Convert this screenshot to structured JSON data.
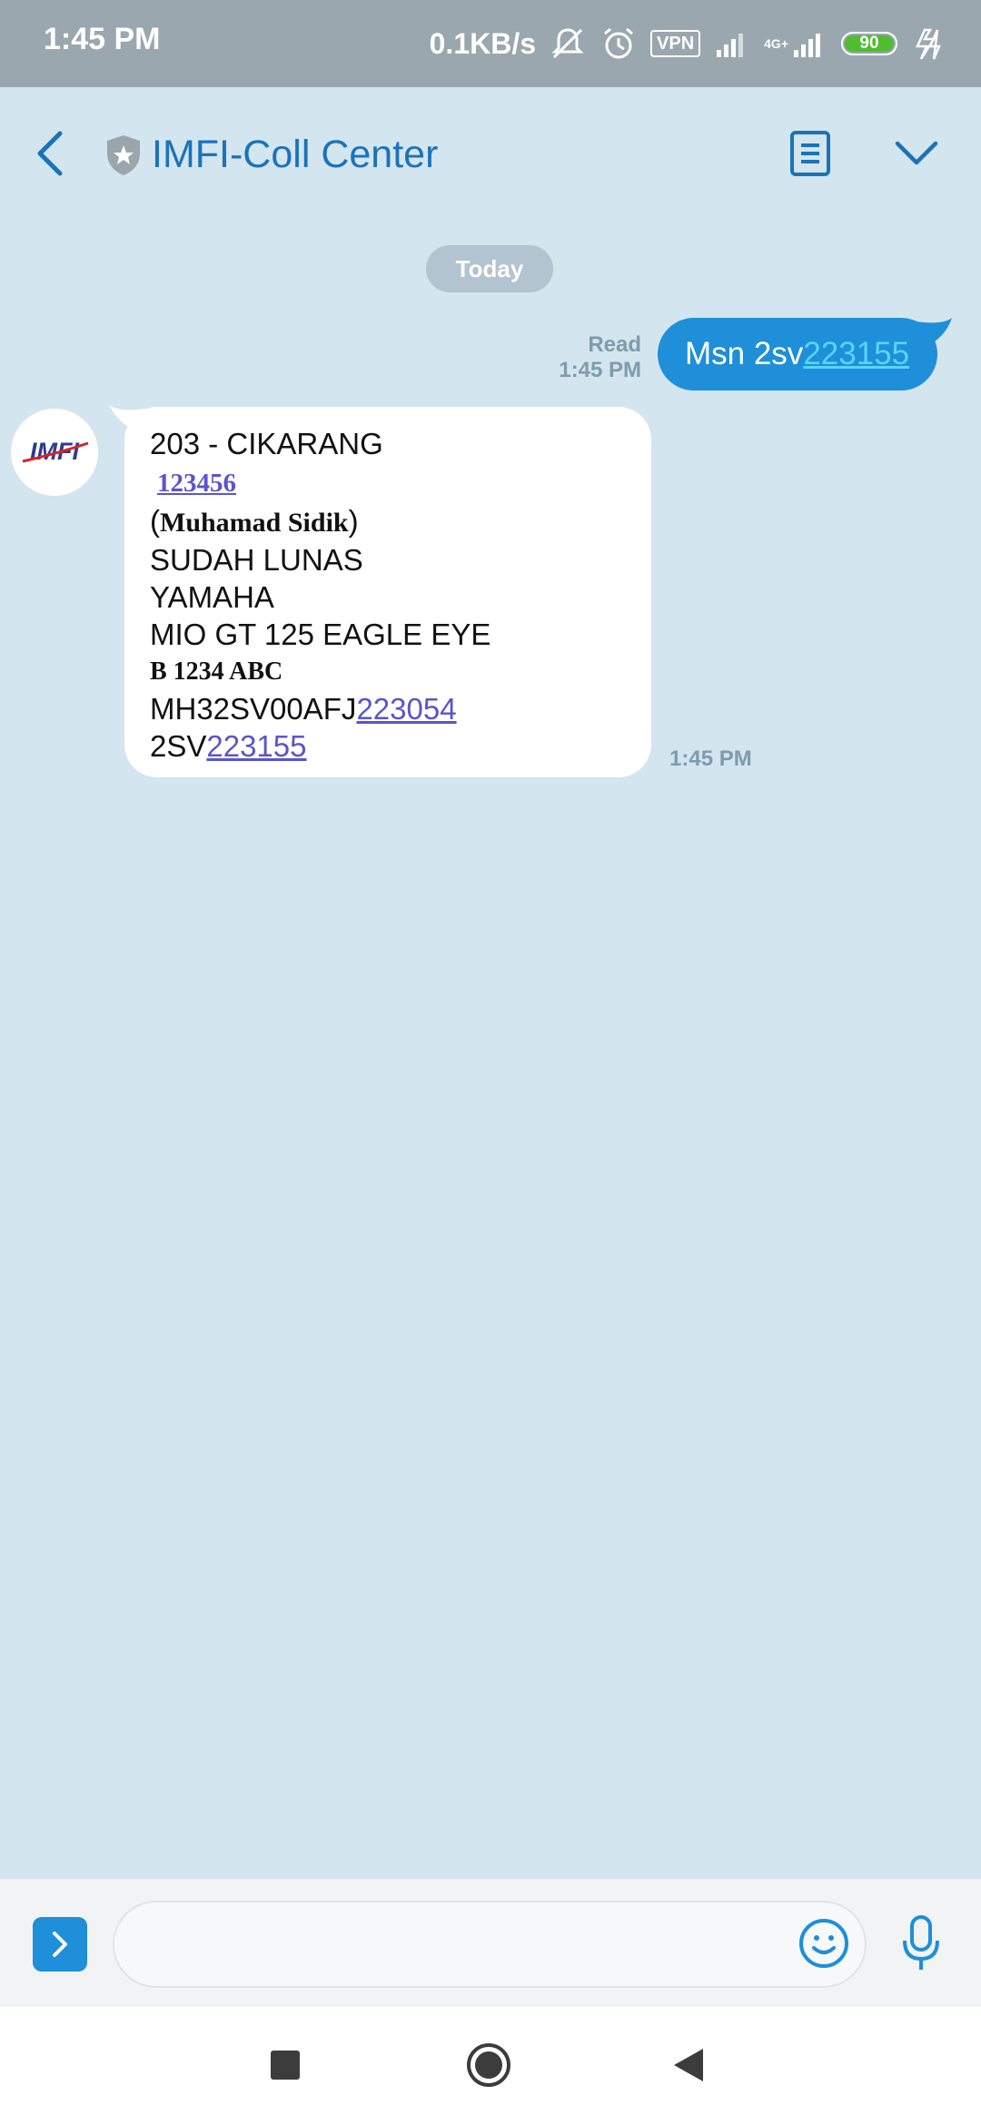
{
  "status_bar": {
    "time": "1:45 PM",
    "speed": "0.1KB/s",
    "vpn": "VPN",
    "network": "4G+",
    "battery": "90"
  },
  "header": {
    "title": "IMFI-Coll Center"
  },
  "date_divider": "Today",
  "outgoing": {
    "read_label": "Read",
    "time": "1:45 PM",
    "text_prefix": "Msn 2sv",
    "text_link": "223155"
  },
  "incoming": {
    "avatar_text": "IMFI",
    "line1": "203 - CIKARANG",
    "line2": "123456",
    "line3_open": "(",
    "line3_name": "Muhamad Sidik",
    "line3_close": ")",
    "line4": "SUDAH LUNAS",
    "line5": "YAMAHA",
    "line6": "MIO GT 125 EAGLE EYE",
    "line7": "B 1234 ABC",
    "line8_prefix": "MH32SV00AFJ",
    "line8_link": "223054",
    "line9_prefix": "2SV",
    "line9_link": "223155",
    "time": "1:45 PM"
  },
  "composer": {
    "placeholder": ""
  },
  "colors": {
    "background": "#d3e5ef",
    "accent": "#1e8fd8",
    "title": "#1a73b8",
    "link": "#5a55cc"
  }
}
